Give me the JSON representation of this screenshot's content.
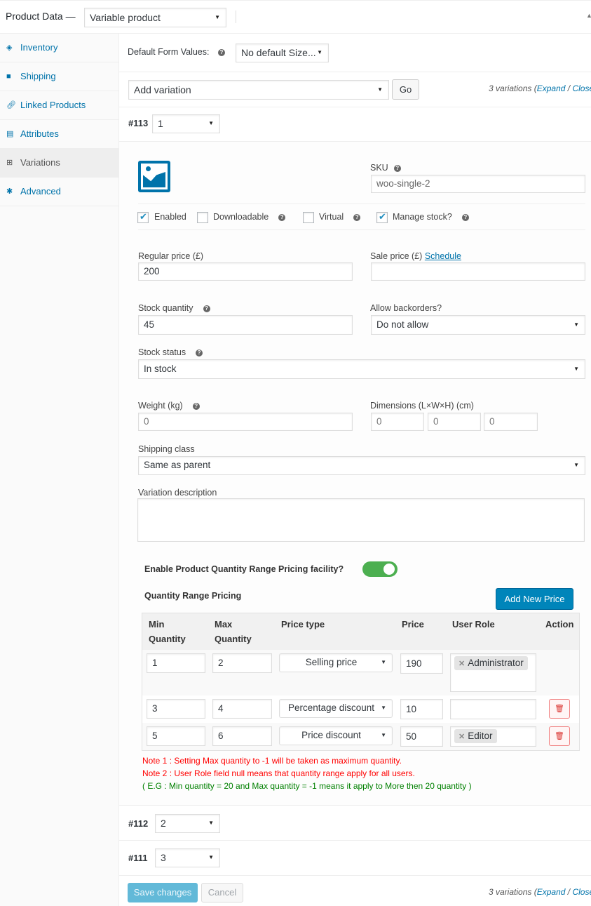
{
  "header": {
    "title": "Product Data —",
    "product_type": "Variable product"
  },
  "sidebar": {
    "items": [
      {
        "label": "Inventory",
        "icon": "tag-icon"
      },
      {
        "label": "Shipping",
        "icon": "truck-icon"
      },
      {
        "label": "Linked Products",
        "icon": "link-icon"
      },
      {
        "label": "Attributes",
        "icon": "list-icon"
      },
      {
        "label": "Variations",
        "icon": "grid-icon",
        "active": true
      },
      {
        "label": "Advanced",
        "icon": "gear-icon"
      }
    ]
  },
  "defaults": {
    "label": "Default Form Values:",
    "value": "No default Size..."
  },
  "toolbar": {
    "action": "Add variation",
    "go": "Go",
    "count": "3 variations",
    "expand": "Expand",
    "sep": " / ",
    "close": "Close"
  },
  "variations": [
    {
      "id": "#113",
      "value": "1"
    },
    {
      "id": "#112",
      "value": "2"
    },
    {
      "id": "#111",
      "value": "3"
    }
  ],
  "form": {
    "sku_label": "SKU",
    "sku": "woo-single-2",
    "enabled": "Enabled",
    "downloadable": "Downloadable",
    "virtual": "Virtual",
    "manage_stock": "Manage stock?",
    "checks": {
      "enabled": true,
      "downloadable": false,
      "virtual": false,
      "manage_stock": true
    },
    "regular_price_label": "Regular price (£)",
    "regular_price": "200",
    "sale_price_label": "Sale price (£)",
    "schedule": "Schedule",
    "sale_price": "",
    "stock_qty_label": "Stock quantity",
    "stock_qty": "45",
    "backorders_label": "Allow backorders?",
    "backorders": "Do not allow",
    "stock_status_label": "Stock status",
    "stock_status": "In stock",
    "weight_label": "Weight (kg)",
    "weight": "0",
    "dimensions_label": "Dimensions (L×W×H) (cm)",
    "length": "0",
    "width": "0",
    "height": "0",
    "shipping_class_label": "Shipping class",
    "shipping_class": "Same as parent",
    "description_label": "Variation description",
    "description": ""
  },
  "qrp": {
    "enable_label": "Enable Product Quantity Range Pricing facility?",
    "enabled": true,
    "toggle_color": "#4caf50",
    "title": "Quantity Range Pricing",
    "add_button": "Add New Price",
    "headers": {
      "min1": "Min",
      "min2": "Quantity",
      "max1": "Max",
      "max2": "Quantity",
      "type": "Price type",
      "price": "Price",
      "role": "User Role",
      "action": "Action"
    },
    "rows": [
      {
        "min": "1",
        "max": "2",
        "type": "Selling price",
        "price": "190",
        "role": "Administrator"
      },
      {
        "min": "3",
        "max": "4",
        "type": "Percentage discount",
        "price": "10",
        "role": ""
      },
      {
        "min": "5",
        "max": "6",
        "type": "Price discount",
        "price": "50",
        "role": "Editor"
      }
    ],
    "note1": "Note 1 : Setting Max quantity to -1 will be taken as maximum quantity.",
    "note2": "Note 2 : User Role field null means that quantity range apply for all users.",
    "note3": "( E.G : Min quantity = 20 and Max quantity = -1 means it apply to More then 20 quantity )"
  },
  "footer": {
    "save": "Save changes",
    "cancel": "Cancel"
  }
}
